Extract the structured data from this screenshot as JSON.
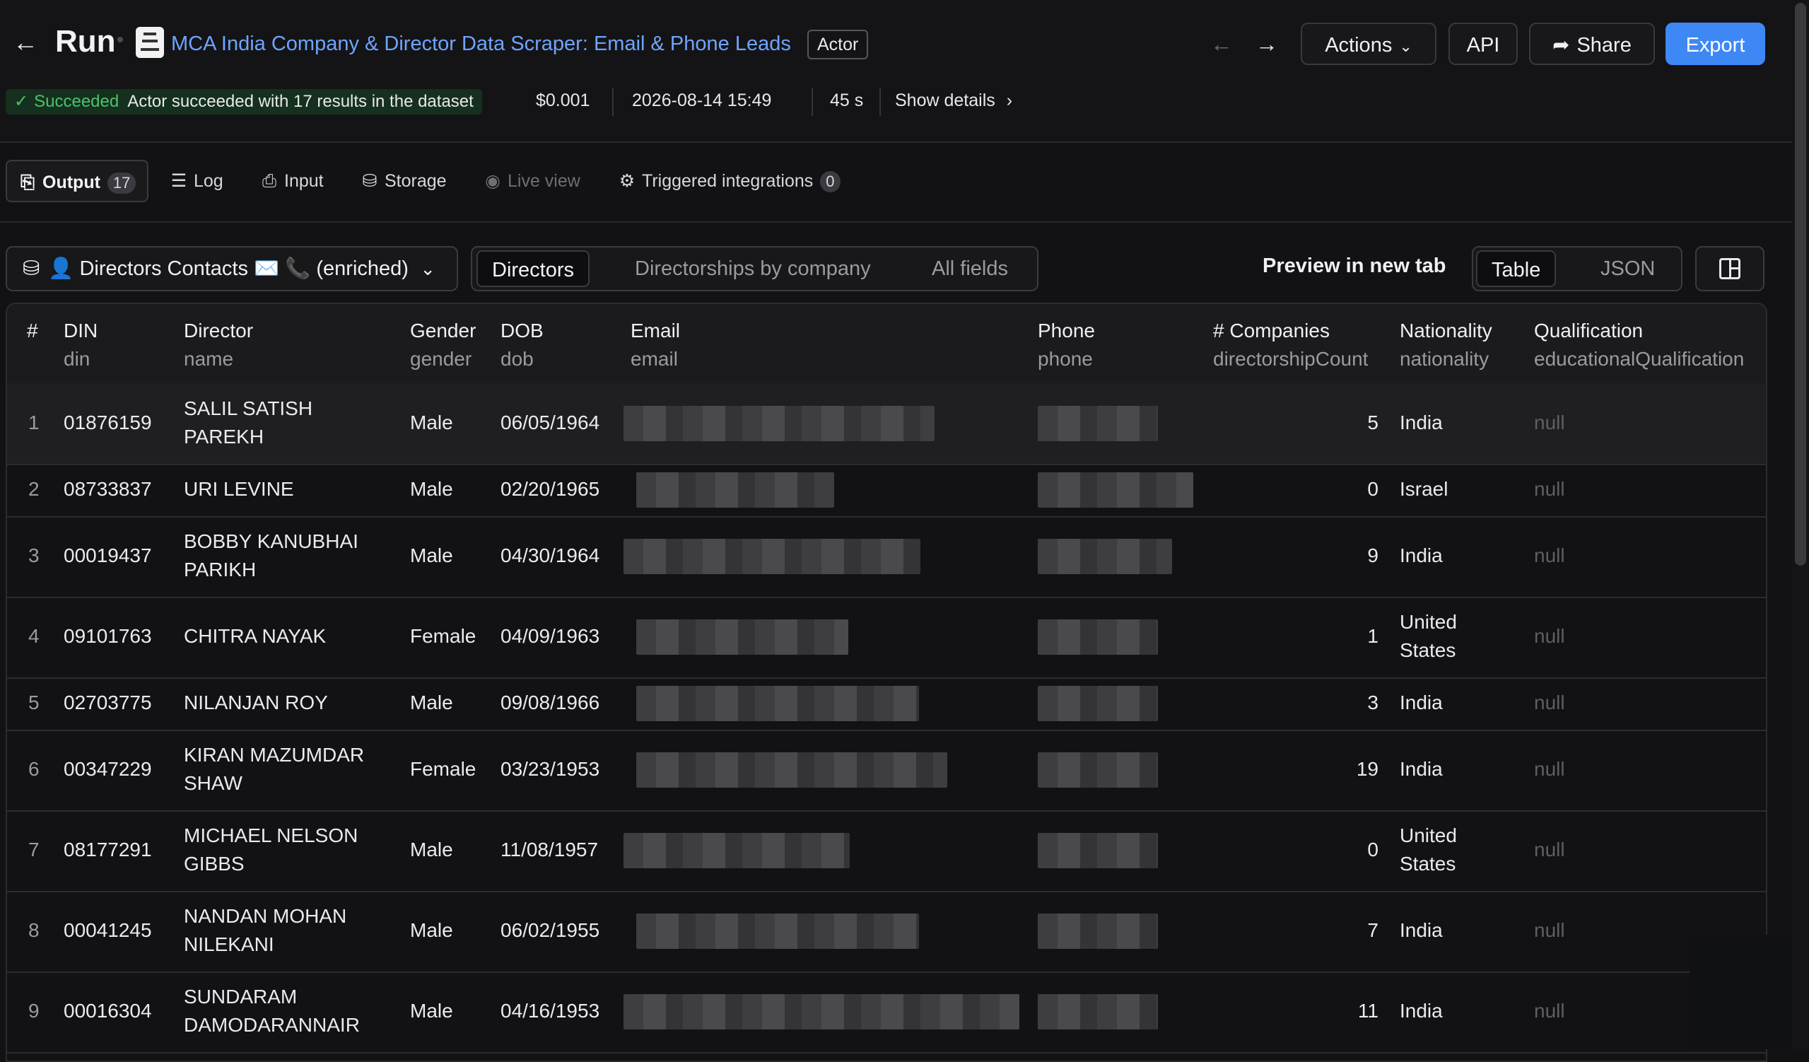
{
  "header": {
    "back_icon": "arrow-left-icon",
    "title": "Run",
    "actor_name": "MCA India Company & Director Data Scraper: Email & Phone Leads",
    "actor_badge": "Actor",
    "actions_label": "Actions",
    "api_label": "API",
    "share_label": "Share",
    "export_label": "Export",
    "accent": "#3e88f6"
  },
  "status": {
    "label": "Succeeded",
    "message": "Actor succeeded with 17 results in the dataset",
    "cost": "$0.001",
    "timestamp": "2026-08-14 15:49",
    "duration": "45 s",
    "details_label": "Show details",
    "color": "#4cc26b"
  },
  "tabs": [
    {
      "label": "Output",
      "count": "17",
      "icon": "output-icon"
    },
    {
      "label": "Log",
      "icon": "log-icon"
    },
    {
      "label": "Input",
      "icon": "input-icon"
    },
    {
      "label": "Storage",
      "icon": "storage-icon"
    },
    {
      "label": "Live view",
      "icon": "eye-icon"
    },
    {
      "label": "Triggered integrations",
      "count": "0",
      "icon": "integrations-icon"
    }
  ],
  "toolbar": {
    "dataset": "👤 Directors Contacts ✉️ 📞 (enriched)",
    "views": [
      "Directors",
      "Directorships by company",
      "All fields"
    ],
    "preview_label": "Preview in new tab",
    "formats": [
      "Table",
      "JSON"
    ]
  },
  "table": {
    "columns": [
      {
        "title": "#",
        "field": ""
      },
      {
        "title": "DIN",
        "field": "din"
      },
      {
        "title": "Director",
        "field": "name"
      },
      {
        "title": "Gender",
        "field": "gender"
      },
      {
        "title": "DOB",
        "field": "dob"
      },
      {
        "title": "Email",
        "field": "email"
      },
      {
        "title": "Phone",
        "field": "phone"
      },
      {
        "title": "# Companies",
        "field": "directorshipCount"
      },
      {
        "title": "Nationality",
        "field": "nationality"
      },
      {
        "title": "Qualification",
        "field": "educationalQualification"
      }
    ],
    "rows": [
      {
        "n": "1",
        "din": "01876159",
        "name1": "SALIL SATISH",
        "name2": "PAREKH",
        "gender": "Male",
        "dob": "06/05/1964",
        "count": "5",
        "nat1": "India",
        "nat2": "",
        "qual": "null"
      },
      {
        "n": "2",
        "din": "08733837",
        "name1": "URI LEVINE",
        "name2": "",
        "gender": "Male",
        "dob": "02/20/1965",
        "count": "0",
        "nat1": "Israel",
        "nat2": "",
        "qual": "null"
      },
      {
        "n": "3",
        "din": "00019437",
        "name1": "BOBBY KANUBHAI",
        "name2": "PARIKH",
        "gender": "Male",
        "dob": "04/30/1964",
        "count": "9",
        "nat1": "India",
        "nat2": "",
        "qual": "null"
      },
      {
        "n": "4",
        "din": "09101763",
        "name1": "CHITRA NAYAK",
        "name2": "",
        "gender": "Female",
        "dob": "04/09/1963",
        "count": "1",
        "nat1": "United",
        "nat2": "States",
        "qual": "null"
      },
      {
        "n": "5",
        "din": "02703775",
        "name1": "NILANJAN ROY",
        "name2": "",
        "gender": "Male",
        "dob": "09/08/1966",
        "count": "3",
        "nat1": "India",
        "nat2": "",
        "qual": "null"
      },
      {
        "n": "6",
        "din": "00347229",
        "name1": "KIRAN MAZUMDAR",
        "name2": "SHAW",
        "gender": "Female",
        "dob": "03/23/1953",
        "count": "19",
        "nat1": "India",
        "nat2": "",
        "qual": "null"
      },
      {
        "n": "7",
        "din": "08177291",
        "name1": "MICHAEL NELSON",
        "name2": "GIBBS",
        "gender": "Male",
        "dob": "11/08/1957",
        "count": "0",
        "nat1": "United",
        "nat2": "States",
        "qual": "null"
      },
      {
        "n": "8",
        "din": "00041245",
        "name1": "NANDAN MOHAN",
        "name2": "NILEKANI",
        "gender": "Male",
        "dob": "06/02/1955",
        "count": "7",
        "nat1": "India",
        "nat2": "",
        "qual": "null"
      },
      {
        "n": "9",
        "din": "00016304",
        "name1": "SUNDARAM",
        "name2": "DAMODARANNAIR",
        "gender": "Male",
        "dob": "04/16/1953",
        "count": "11",
        "nat1": "India",
        "nat2": "",
        "qual": "null"
      }
    ]
  }
}
